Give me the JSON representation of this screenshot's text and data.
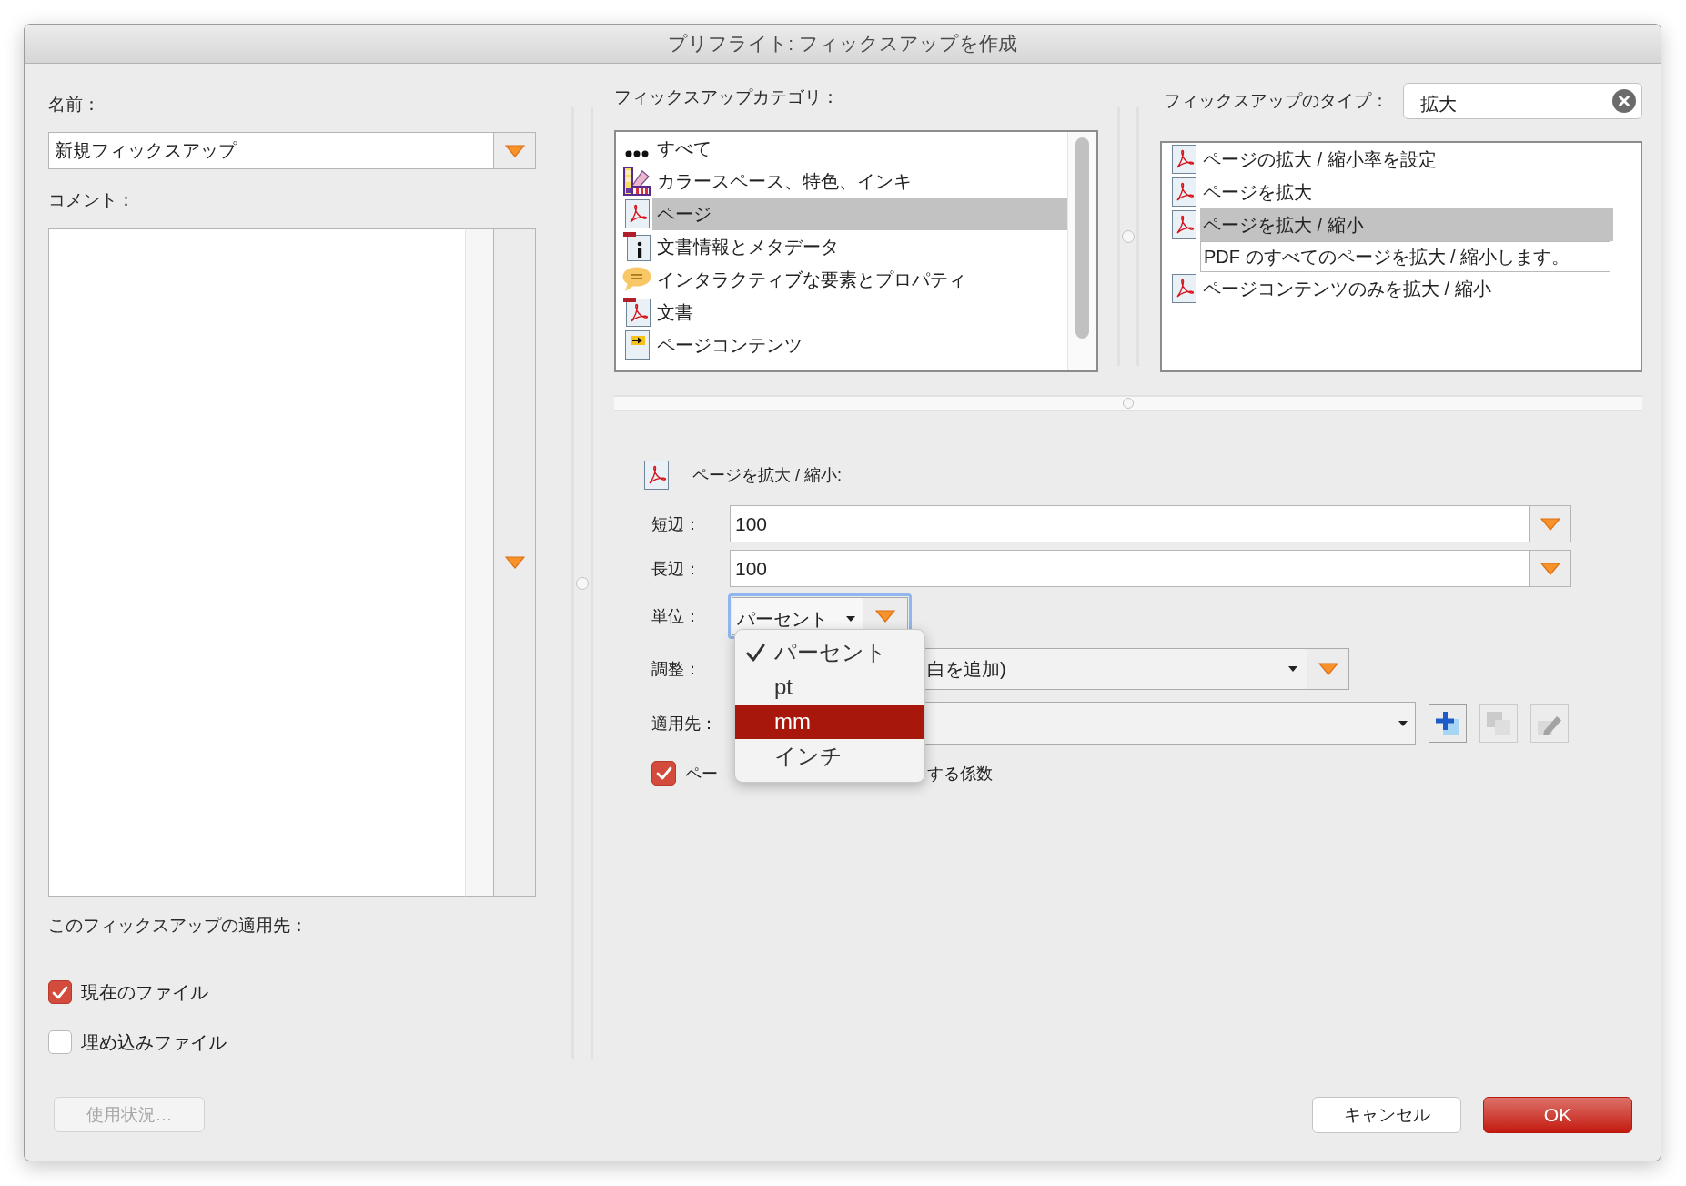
{
  "window": {
    "title": "プリフライト: フィックスアップを作成"
  },
  "name": {
    "label": "名前：",
    "value": "新規フィックスアップ"
  },
  "comment": {
    "label": "コメント："
  },
  "apply_to": {
    "label": "このフィックスアップの適用先：",
    "options": [
      {
        "label": "現在のファイル",
        "checked": true
      },
      {
        "label": "埋め込みファイル",
        "checked": false
      }
    ]
  },
  "usage_button": {
    "label": "使用状況…",
    "disabled": true
  },
  "categories": {
    "label": "フィックスアップカテゴリ：",
    "items": [
      {
        "kind": "dots",
        "label": "すべて",
        "selected": false
      },
      {
        "kind": "swatches",
        "label": "カラースペース、特色、インキ",
        "selected": false
      },
      {
        "kind": "page",
        "label": "ページ",
        "selected": true
      },
      {
        "kind": "info",
        "label": "文書情報とメタデータ",
        "selected": false
      },
      {
        "kind": "bubble",
        "label": "インタラクティブな要素とプロパティ",
        "selected": false
      },
      {
        "kind": "document",
        "label": "文書",
        "selected": false
      },
      {
        "kind": "arrow",
        "label": "ページコンテンツ",
        "selected": false
      }
    ]
  },
  "types": {
    "label": "フィックスアップのタイプ：",
    "search": {
      "value": "拡大"
    },
    "items": [
      {
        "label": "ページの拡大 / 縮小率を設定",
        "selected": false
      },
      {
        "label": "ページを拡大",
        "selected": false
      },
      {
        "label": "ページを拡大 / 縮小",
        "selected": true
      },
      {
        "label": "ページコンテンツのみを拡大 / 縮小",
        "selected": false
      }
    ],
    "tooltip": "PDF のすべてのページを拡大 / 縮小します。"
  },
  "settings": {
    "title": "ページを拡大 / 縮小:",
    "fields": [
      {
        "kind": "text",
        "label": "短辺：",
        "value": "100"
      },
      {
        "kind": "text",
        "label": "長辺：",
        "value": "100"
      },
      {
        "kind": "unit",
        "label": "単位：",
        "value": "パーセント",
        "focused": true
      },
      {
        "kind": "select",
        "label": "調整：",
        "value": "白を追加)"
      },
      {
        "kind": "preset",
        "label": "適用先：",
        "buttons": [
          {
            "kind": "add",
            "disabled": false
          },
          {
            "kind": "duplicate",
            "disabled": true
          },
          {
            "kind": "edit",
            "disabled": true
          }
        ]
      }
    ],
    "checkbox": {
      "checked": true,
      "label_start": "ペー",
      "label_end": "する係数"
    }
  },
  "unit_menu": {
    "items": [
      {
        "label": "パーセント",
        "checked": true,
        "selected": false
      },
      {
        "label": "pt",
        "checked": false,
        "selected": false
      },
      {
        "label": "mm",
        "checked": false,
        "selected": true
      },
      {
        "label": "インチ",
        "checked": false,
        "selected": false
      }
    ]
  },
  "buttons": [
    {
      "label": "キャンセル",
      "primary": false
    },
    {
      "label": "OK",
      "primary": true
    }
  ]
}
